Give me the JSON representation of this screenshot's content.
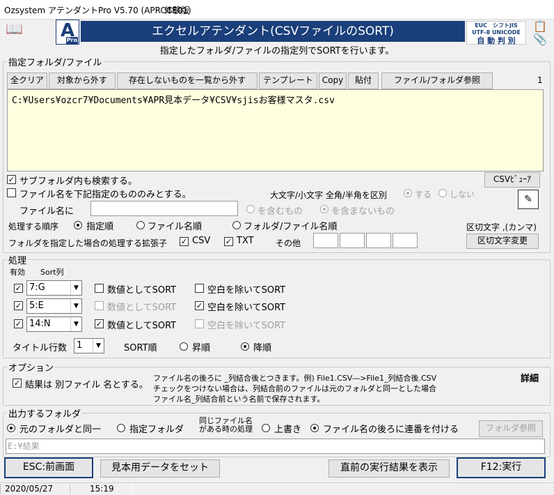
{
  "window": {
    "title": "Ozsystem アテンダントPro V5.70 (APRCCE01)",
    "edition": "体験版"
  },
  "header": {
    "logo_letter": "A",
    "logo_sub": "Pro",
    "banner": "エクセルアテンダント(CSVファイルのSORT)",
    "encoding_line1": "EUC　シフトJIS",
    "encoding_line2": "UTF-8 UNICODE",
    "encoding_line3": "自 動 判 別",
    "subtitle": "指定したフォルダ/ファイルの指定列でSORTを行います。"
  },
  "files": {
    "legend": "指定フォルダ/ファイル",
    "buttons": {
      "clear_all": "全クリア",
      "remove": "対象から外す",
      "remove_missing": "存在しないものを一覧から外す",
      "template": "テンプレート",
      "copy": "Copy",
      "paste": "貼付",
      "browse": "ファイル/フォルダ参照"
    },
    "count": "1",
    "paths": "C:¥Users¥ozcr7¥Documents¥APR見本データ¥CSV¥sjisお客様マスタ.csv",
    "csv_viewer": "CSVﾋﾞｭｰｱ",
    "search_subfolders": "サブフォルダ内も検索する。",
    "name_filter_only": "ファイル名を下記指定のもののみとする。",
    "case_label": "大文字/小文字 全角/半角を区別",
    "case_yes": "する",
    "case_no": "しない",
    "filename_label": "ファイル名に",
    "contains": "を含むもの",
    "not_contains": "を含まないもの",
    "order_label": "処理する順序",
    "order_specified": "指定順",
    "order_filename": "ファイル名順",
    "order_folder": "フォルダ/ファイル名順",
    "delimiter_label": "区切文字 ,(カンマ)",
    "ext_label": "フォルダを指定した場合の処理する拡張子",
    "ext_csv": "CSV",
    "ext_txt": "TXT",
    "ext_other": "その他",
    "delimiter_change": "区切文字変更"
  },
  "process": {
    "legend": "処理",
    "col_enabled": "有効",
    "col_sort": "Sort列",
    "rows": [
      {
        "column": "7:G",
        "numeric_label": "数値としてSORT",
        "numeric": false,
        "numeric_enabled": true,
        "trim_label": "空白を除いてSORT",
        "trim": false,
        "trim_enabled": true
      },
      {
        "column": "5:E",
        "numeric_label": "数値としてSORT",
        "numeric": false,
        "numeric_enabled": false,
        "trim_label": "空白を除いてSORT",
        "trim": true,
        "trim_enabled": true
      },
      {
        "column": "14:N",
        "numeric_label": "数値としてSORT",
        "numeric": true,
        "numeric_enabled": true,
        "trim_label": "空白を除いてSORT",
        "trim": false,
        "trim_enabled": false
      }
    ],
    "title_rows_label": "タイトル行数",
    "title_rows": "1",
    "sort_order_label": "SORT順",
    "asc": "昇順",
    "desc": "降順"
  },
  "options": {
    "legend": "オプション",
    "separate_file": "結果は 別ファイル 名とする。",
    "note1": "ファイル名の後ろに _列結合後とつきます。例) File1.CSV―>File1_列結合後.CSV",
    "note2": "チェックをつけない場合は、列結合前のファイルは元のフォルダと同一とした場合",
    "note3": "ファイル名_列結合前という名前で保存されます。",
    "detail": "詳細"
  },
  "output": {
    "legend": "出力するフォルダ",
    "same_folder": "元のフォルダと同一",
    "specified_folder": "指定フォルダ",
    "same_name_label": "同じファイル名\nがある時の処理",
    "overwrite": "上書き",
    "append_number": "ファイル名の後ろに連番を付ける",
    "folder_browse": "フォルダ参照",
    "path_placeholder": "E:¥結果"
  },
  "footer": {
    "back": "ESC:前画面",
    "sample": "見本用データをセット",
    "show_last": "直前の実行結果を表示",
    "run": "F12:実行"
  },
  "status": {
    "date": "2020/05/27",
    "time": "15:19"
  }
}
